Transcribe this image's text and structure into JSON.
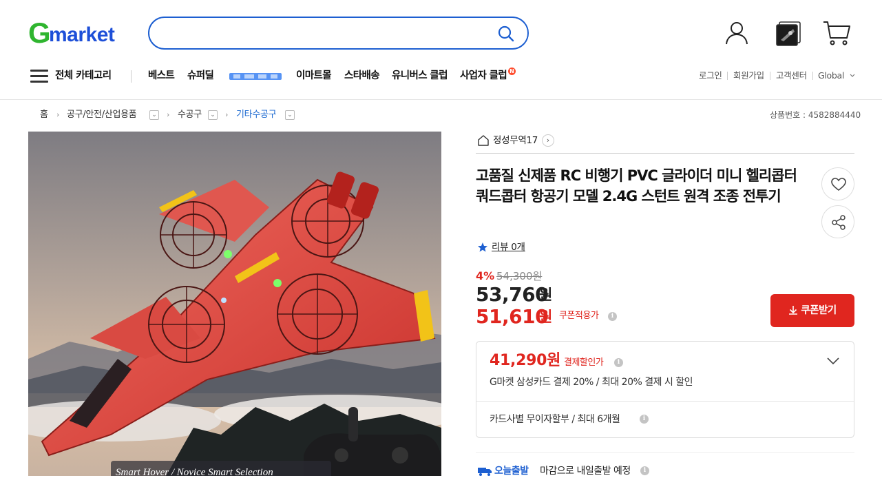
{
  "header": {
    "logo_g": "G",
    "logo_text": "market",
    "search_placeholder": "",
    "icons": [
      "user-icon",
      "recent-item-icon",
      "cart-icon"
    ]
  },
  "nav": {
    "all_categories": "전체 카테고리",
    "items": [
      "베스트",
      "슈퍼딜",
      "이마트몰",
      "스타배송",
      "유니버스 클럽",
      "사업자 클럽"
    ],
    "promo_label": "",
    "new_badge": "N",
    "util_links": [
      "로그인",
      "회원가입",
      "고객센터",
      "Global"
    ]
  },
  "breadcrumb": {
    "home": "홈",
    "levels": [
      "공구/안전/산업용품",
      "수공구",
      "기타수공구"
    ],
    "product_no": "상품번호 : 4582884440"
  },
  "product": {
    "image_caption": "Smart Hover / Novice Smart Selection",
    "seller": "정성무역17",
    "title": "고품질 신제품 RC 비행기 PVC 글라이더 미니 헬리콥터 쿼드콥터 항공기 모델 2.4G 스턴트 원격 조종 전투기",
    "review_label": "리뷰 0개",
    "discount_rate": "4%",
    "original_price": "54,300원",
    "sale_price": "53,760",
    "coupon_price": "51,610",
    "won": "원",
    "coupon_applied_label": "쿠폰적용가",
    "coupon_button": "쿠폰받기"
  },
  "payment": {
    "price": "41,290원",
    "label": "결제할인가",
    "desc": "G마켓 삼성카드 결제 20% / 최대 20% 결제 시 할인",
    "installment": "카드사별 무이자할부 / 최대 6개월"
  },
  "shipping": {
    "badge": "오늘출발",
    "text": "마감으로 내일출발 예정"
  },
  "colors": {
    "brand_green": "#2fb52f",
    "brand_blue": "#1d4fd8",
    "accent_red": "#e0261f"
  }
}
